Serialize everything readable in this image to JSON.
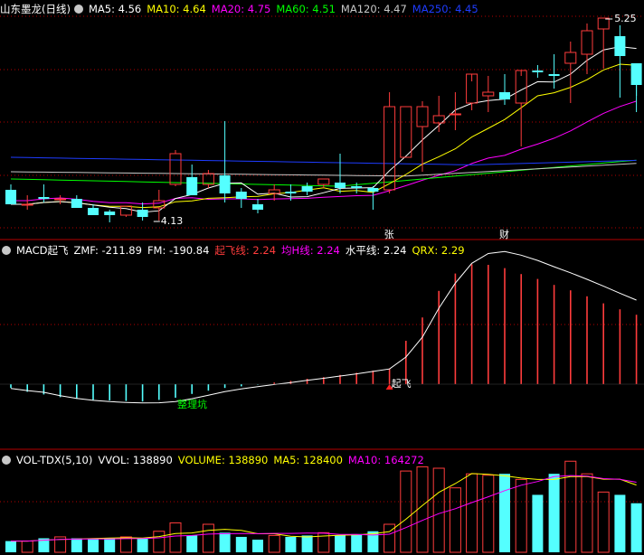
{
  "theme": {
    "bg": "#000000",
    "up": "#ff3c3c",
    "down": "#54ffff",
    "grid": "#b40000",
    "ma5": "#ffffff",
    "ma10": "#ffff00",
    "ma20": "#ff00ff",
    "ma60": "#00ff00",
    "ma120": "#c8c8c8",
    "ma250": "#1e3cff"
  },
  "header1": {
    "title": "山东墨龙(日线)",
    "icon": "circle-menu-icon",
    "ma5": "MA5: 4.56",
    "ma10": "MA10: 4.64",
    "ma20": "MA20: 4.75",
    "ma60": "MA60: 4.51",
    "ma120": "MA120: 4.47",
    "ma250": "MA250: 4.45"
  },
  "header2": {
    "title": "MACD起飞",
    "zmf": "ZMF: -211.89",
    "fm": "FM: -190.84",
    "qfx": "起飞线: 2.24",
    "jhx": "均H线: 2.24",
    "spx": "水平线: 2.24",
    "qrx": "QRX: 2.29"
  },
  "header3": {
    "title": "VOL-TDX(5,10)",
    "vvol": "VVOL: 138890",
    "volume": "VOLUME: 138890",
    "ma5": "MA5: 128400",
    "ma10": "MA10: 164272"
  },
  "annotations": {
    "high": "5.25",
    "low": "4.13",
    "zhang": "张",
    "cai": "财",
    "qifei": "起飞",
    "zhenglikeng": "整理坑"
  },
  "chart_data": [
    {
      "type": "candlestick",
      "title": "山东墨龙(日线)",
      "candles": [
        [
          4.3,
          4.33,
          4.22,
          4.22
        ],
        [
          4.22,
          4.27,
          4.19,
          4.22
        ],
        [
          4.26,
          4.33,
          4.23,
          4.25
        ],
        [
          4.25,
          4.27,
          4.22,
          4.25
        ],
        [
          4.25,
          4.27,
          4.2,
          4.2
        ],
        [
          4.2,
          4.22,
          4.16,
          4.16
        ],
        [
          4.18,
          4.19,
          4.12,
          4.16
        ],
        [
          4.16,
          4.21,
          4.15,
          4.21
        ],
        [
          4.19,
          4.23,
          4.13,
          4.15
        ],
        [
          4.2,
          4.3,
          4.13,
          4.24
        ],
        [
          4.33,
          4.52,
          4.32,
          4.5
        ],
        [
          4.37,
          4.44,
          4.28,
          4.27
        ],
        [
          4.33,
          4.41,
          4.31,
          4.39
        ],
        [
          4.38,
          4.68,
          4.23,
          4.28
        ],
        [
          4.29,
          4.31,
          4.2,
          4.25
        ],
        [
          4.22,
          4.25,
          4.17,
          4.19
        ],
        [
          4.28,
          4.33,
          4.24,
          4.3
        ],
        [
          4.29,
          4.33,
          4.24,
          4.28
        ],
        [
          4.32,
          4.34,
          4.27,
          4.29
        ],
        [
          4.33,
          4.36,
          4.31,
          4.36
        ],
        [
          4.34,
          4.5,
          4.28,
          4.31
        ],
        [
          4.32,
          4.34,
          4.28,
          4.31
        ],
        [
          4.31,
          4.32,
          4.19,
          4.29
        ],
        [
          4.3,
          4.84,
          4.28,
          4.76
        ],
        [
          4.48,
          4.76,
          4.48,
          4.76
        ],
        [
          4.65,
          4.79,
          4.4,
          4.76
        ],
        [
          4.67,
          4.82,
          4.62,
          4.71
        ],
        [
          4.72,
          4.84,
          4.63,
          4.72
        ],
        [
          4.78,
          4.9,
          4.74,
          4.94
        ],
        [
          4.82,
          4.93,
          4.73,
          4.84
        ],
        [
          4.84,
          4.94,
          4.77,
          4.8
        ],
        [
          4.78,
          4.93,
          4.54,
          4.96
        ],
        [
          4.96,
          4.99,
          4.92,
          4.95
        ],
        [
          4.94,
          5.05,
          4.86,
          4.93
        ],
        [
          5.0,
          5.12,
          4.78,
          5.06
        ],
        [
          5.05,
          5.22,
          4.94,
          5.18
        ],
        [
          5.19,
          5.25,
          4.97,
          5.25
        ],
        [
          5.15,
          5.21,
          4.81,
          5.04
        ],
        [
          5.0,
          4.82,
          4.73,
          4.88
        ]
      ],
      "ma_values": {
        "MA5": 4.56,
        "MA10": 4.64,
        "MA20": 4.75,
        "MA60": 4.51,
        "MA120": 4.47,
        "MA250": 4.45
      },
      "annotations": [
        "5.25",
        "4.13",
        "张",
        "财"
      ]
    },
    {
      "type": "bar",
      "title": "MACD起飞",
      "series": [
        {
          "name": "ZMF",
          "values": [
            -7,
            -14,
            -19,
            -24,
            -27,
            -29,
            -30,
            -31,
            -32,
            -29,
            -25,
            -18,
            -12,
            -7,
            -4,
            -1,
            3,
            6,
            10,
            13,
            17,
            21,
            25,
            29,
            80,
            123,
            172,
            204,
            221,
            220,
            214,
            203,
            194,
            183,
            173,
            162,
            149,
            138,
            128
          ]
        }
      ],
      "values_text": {
        "ZMF": -211.89,
        "FM": -190.84,
        "起飞线": 2.24,
        "均H线": 2.24,
        "水平线": 2.24,
        "QRX": 2.29
      }
    },
    {
      "type": "bar",
      "title": "VOL-TDX(5,10)",
      "values": [
        8,
        8,
        10,
        11,
        10,
        10,
        10,
        11,
        10,
        15,
        21,
        12,
        20,
        14,
        11,
        9,
        12,
        11,
        12,
        14,
        12,
        13,
        15,
        20,
        58,
        61,
        60,
        46,
        56,
        55,
        56,
        52,
        41,
        56,
        65,
        56,
        43,
        41,
        35
      ],
      "values_text": {
        "VVOL": 138890,
        "VOLUME": 138890,
        "MA5": 128400,
        "MA10": 164272
      }
    }
  ]
}
